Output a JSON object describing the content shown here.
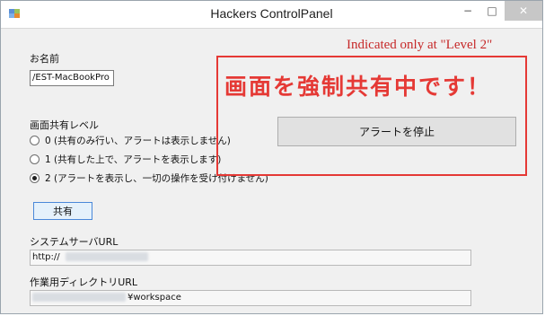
{
  "window": {
    "title": "Hackers ControlPanel",
    "controls": {
      "minimize": "−",
      "maximize": "□",
      "close": "✕"
    }
  },
  "form": {
    "name_label": "お名前",
    "name_value": "/EST-MacBookPro",
    "share_level_label": "画面共有レベル",
    "levels": [
      {
        "label": "0 (共有のみ行い、アラートは表示しません)",
        "checked": false
      },
      {
        "label": "1 (共有した上で、アラートを表示します)",
        "checked": false
      },
      {
        "label": "2 (アラートを表示し、一切の操作を受け付けません)",
        "checked": true
      }
    ],
    "share_button": "共有",
    "system_url_label": "システムサーバURL",
    "system_url_value": "http://",
    "work_dir_label": "作業用ディレクトリURL",
    "work_dir_suffix": "¥workspace"
  },
  "alert": {
    "note": "Indicated only at \"Level 2\"",
    "title": "画面を強制共有中です！",
    "stop_button": "アラートを停止"
  },
  "colors": {
    "alert_red": "#e53935",
    "accent_blue": "#4a88d9"
  }
}
